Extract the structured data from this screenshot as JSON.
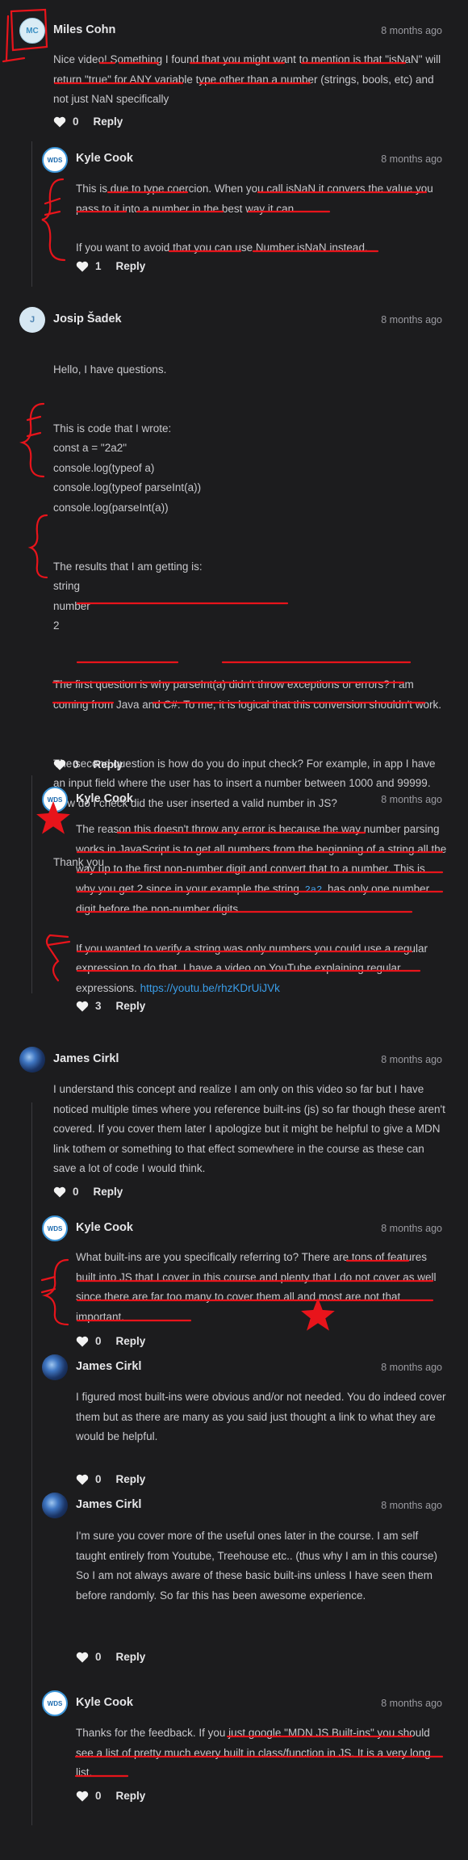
{
  "comments": [
    {
      "author": "Miles Cohn",
      "initials": "MC",
      "time": "8 months ago",
      "text": [
        "Nice video! Something I found that you might want to mention is that \"isNaN\" will return \"true\" for ANY variable type other than a number (strings, bools, etc) and not just NaN specifically"
      ],
      "likes": "0",
      "reply_label": "Reply"
    },
    {
      "author": "Kyle Cook",
      "initials": "WDS",
      "time": "8 months ago",
      "text": [
        "This is due to type coercion. When you call isNaN it convers the value you pass to it into a number in the best way it can.",
        "If you want to avoid that you can use Number.isNaN instead."
      ],
      "likes": "1",
      "reply_label": "Reply"
    },
    {
      "author": "Josip Šadek",
      "initials": "J",
      "time": "8 months ago",
      "text": [
        "Hello, I have questions.",
        "This is code that I wrote:\nconst a = \"2a2\"\nconsole.log(typeof a)\nconsole.log(typeof parseInt(a))\nconsole.log(parseInt(a))",
        "The results that I am getting is:\nstring\nnumber\n2",
        "The first question is why parseInt(a) didn't throw exceptions or errors? I am coming from Java and C#. To me, it is logical that this conversion shouldn't work.",
        "The second question is how do you do input check? For example, in app I have an input field where the user has to insert a number between 1000 and 99999. How do I check did the user inserted a valid number in JS?",
        "Thank you"
      ],
      "likes": "0",
      "reply_label": "Reply"
    },
    {
      "author": "Kyle Cook",
      "initials": "WDS",
      "time": "8 months ago",
      "text_a": "The reason this doesn't throw any error is because the way number parsing works in JavaScript is to get all numbers from the beginning of a string all the way up to the first non-number digit and convert that to a number. This is why you get 2 since in your example the string",
      "code": "2a2",
      "text_b": "has only one number digit before the non-number digits.",
      "text_c": "If you wanted to verify a string was only numbers you could use a regular expression to do that. I have a video on YouTube explaining regular expressions.",
      "link": "https://youtu.be/rhzKDrUiJVk",
      "likes": "3",
      "reply_label": "Reply"
    },
    {
      "author": "James Cirkl",
      "initials": "",
      "time": "8 months ago",
      "text": [
        "I understand this concept and realize I am only on this video so far but I have noticed multiple times where you reference built-ins (js) so far though these aren't covered. If you cover them later I apologize but it might be helpful to give a MDN link tothem or something to that effect somewhere in the course as these can save a lot of code I would think."
      ],
      "likes": "0",
      "reply_label": "Reply"
    },
    {
      "author": "Kyle Cook",
      "initials": "WDS",
      "time": "8 months ago",
      "text": [
        "What built-ins are you specifically referring to? There are tons of features built into JS that I cover in this course and plenty that I do not cover as well since there are far too many to cover them all and most are not that important."
      ],
      "likes": "0",
      "reply_label": "Reply"
    },
    {
      "author": "James Cirkl",
      "initials": "",
      "time": "8 months ago",
      "text": [
        "I figured most built-ins were obvious and/or not needed. You do indeed cover them but as there are many as you said just thought a link to what they are would be helpful."
      ],
      "likes": "0",
      "reply_label": "Reply"
    },
    {
      "author": "James Cirkl",
      "initials": "",
      "time": "8 months ago",
      "text": [
        "I'm sure you cover more of the useful ones later in the course. I am self taught entirely from Youtube, Treehouse etc.. (thus why I am in this course) So I am not always aware of these basic built-ins unless I have seen them before randomly. So far this has been awesome experience."
      ],
      "likes": "0",
      "reply_label": "Reply"
    },
    {
      "author": "Kyle Cook",
      "initials": "WDS",
      "time": "8 months ago",
      "text": [
        "Thanks for the feedback. If you just google \"MDN JS Built-ins\" you should see a list of pretty much every built in class/function in JS. It is a very long list."
      ],
      "likes": "0",
      "reply_label": "Reply"
    }
  ],
  "colors": {
    "background": "#1c1c1e",
    "text": "#c8c8cc",
    "link": "#3a9de8",
    "annotation": "#e8141b"
  }
}
